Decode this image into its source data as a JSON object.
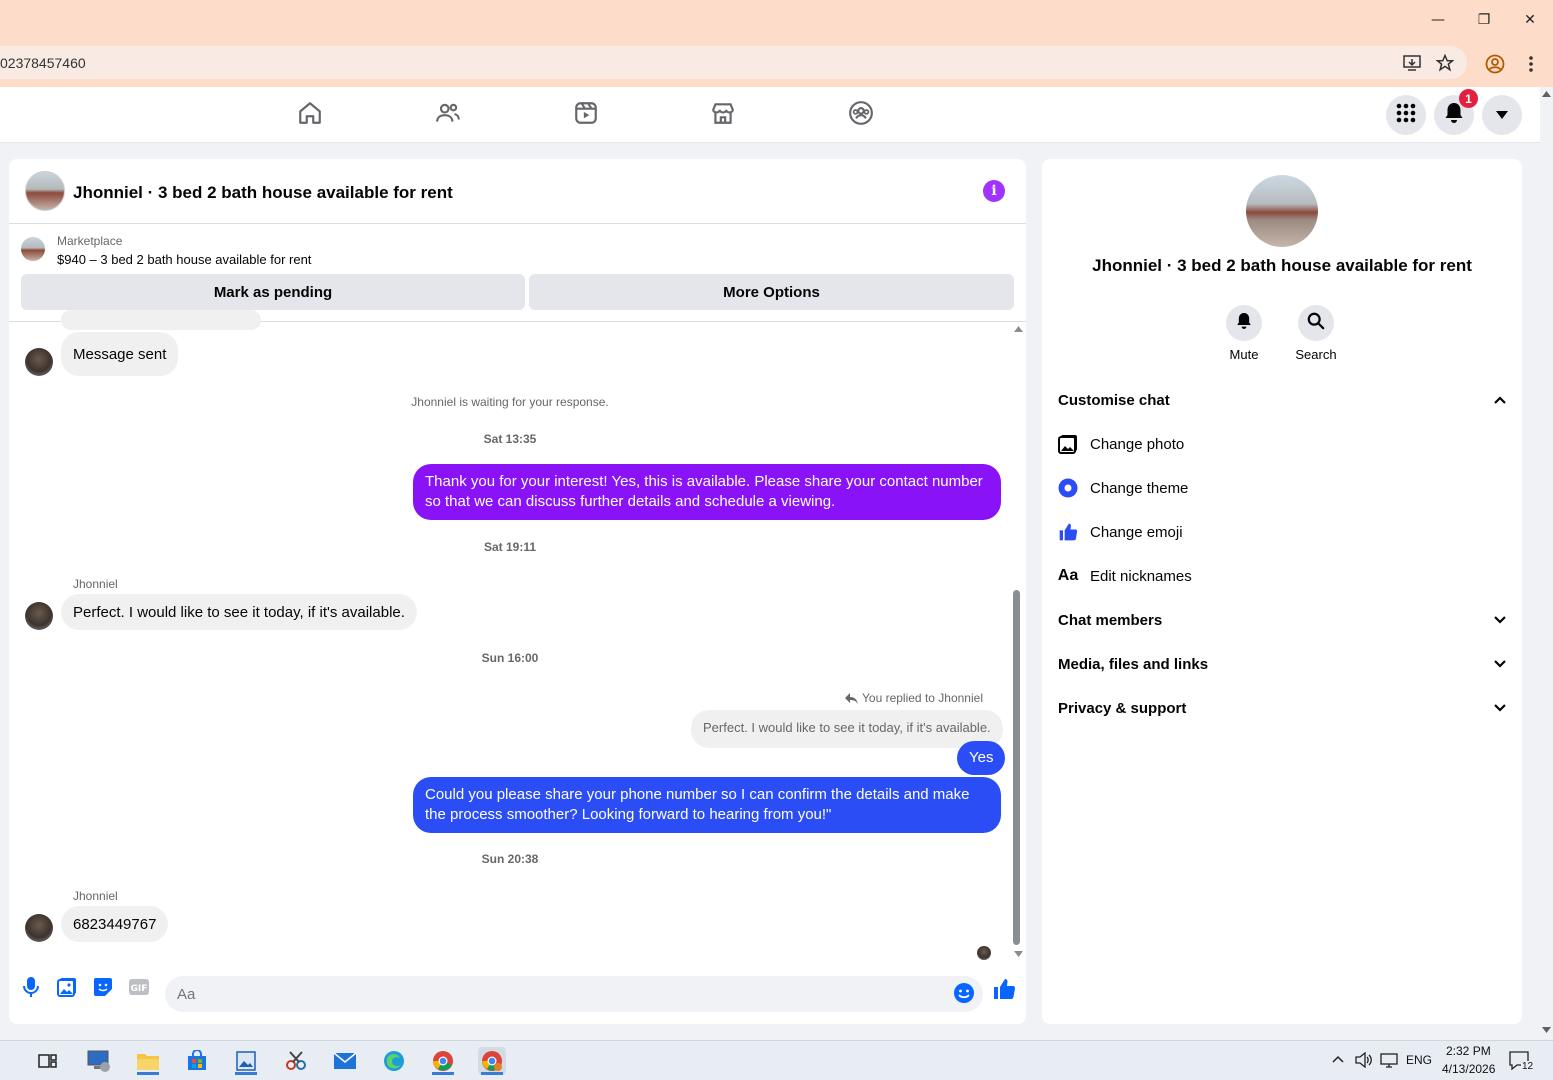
{
  "browser": {
    "url": "02378457460",
    "icons": [
      "install-icon",
      "star-icon",
      "profile-icon",
      "kebab-menu-icon"
    ]
  },
  "fb_nav": {
    "tabs": [
      "home-icon",
      "friends-icon",
      "video-icon",
      "marketplace-icon",
      "groups-icon"
    ],
    "notification_count": "1"
  },
  "chat": {
    "title": "Jhonniel · 3 bed 2 bath house available for rent",
    "marketplace_label": "Marketplace",
    "listing": "$940 – 3 bed 2 bath house available for rent",
    "mark_pending": "Mark as pending",
    "more_options": "More Options",
    "messages": {
      "m1": "Message sent",
      "waiting": "Jhonniel is waiting for your response.",
      "t1": "Sat 13:35",
      "m2": "Thank you for your interest! Yes, this is available. Please share your contact number so that we can discuss further details and schedule a viewing.",
      "t2": "Sat 19:11",
      "sender1": "Jhonniel",
      "m3": "Perfect. I would like to see it today, if it's available.",
      "t3": "Sun 16:00",
      "replied": "You replied to Jhonniel",
      "quoted": "Perfect. I would like to see it today, if it's available.",
      "m4": "Yes",
      "m5": "Could you please share your phone number so I can confirm the details and make the process smoother? Looking forward to hearing from you!\"",
      "t4": "Sun 20:38",
      "sender2": "Jhonniel",
      "m6": "6823449767"
    },
    "input_placeholder": "Aa",
    "colors": {
      "purple": "#8a12f7",
      "blue": "#2b4df5",
      "accent": "#0866ff"
    }
  },
  "info": {
    "name": "Jhonniel · 3 bed 2 bath house available for rent",
    "mute": "Mute",
    "search": "Search",
    "customise": "Customise chat",
    "change_photo": "Change photo",
    "change_theme": "Change theme",
    "change_emoji": "Change emoji",
    "edit_nicknames": "Edit nicknames",
    "chat_members": "Chat members",
    "media": "Media, files and links",
    "privacy": "Privacy & support",
    "nicknames_glyph": "Aa"
  },
  "taskbar": {
    "lang": "ENG",
    "time": "2:32 PM",
    "date": "4/13/2026",
    "notifications": "12"
  }
}
